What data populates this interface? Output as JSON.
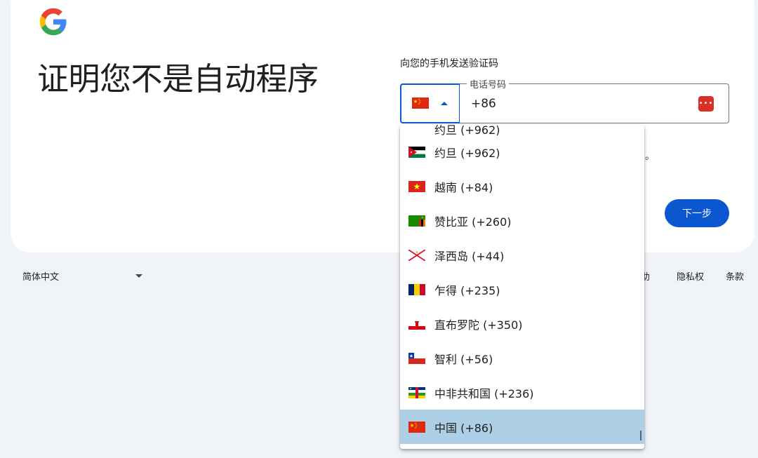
{
  "page": {
    "title": "证明您不是自动程序",
    "subtitle": "向您的手机发送验证码"
  },
  "country_select": {
    "selected_flag": "cn-flag-icon",
    "caret": "caret-up-icon"
  },
  "phone": {
    "label": "电话号码",
    "value": "+86",
    "password_manager_icon": "password-manager-icon"
  },
  "hidden_text_fragment": "。",
  "next_button": {
    "label": "下一步"
  },
  "dropdown": {
    "partial_item_top": "约旦 (+962)",
    "items": [
      {
        "label": "约旦 (+962)",
        "flag": "jordan-flag-icon",
        "selected": false
      },
      {
        "label": "越南 (+84)",
        "flag": "vietnam-flag-icon",
        "selected": false
      },
      {
        "label": "赞比亚 (+260)",
        "flag": "zambia-flag-icon",
        "selected": false
      },
      {
        "label": "泽西岛 (+44)",
        "flag": "jersey-flag-icon",
        "selected": false
      },
      {
        "label": "乍得 (+235)",
        "flag": "chad-flag-icon",
        "selected": false
      },
      {
        "label": "直布罗陀 (+350)",
        "flag": "gibraltar-flag-icon",
        "selected": false
      },
      {
        "label": "智利 (+56)",
        "flag": "chile-flag-icon",
        "selected": false
      },
      {
        "label": "中非共和国 (+236)",
        "flag": "central-african-republic-flag-icon",
        "selected": false
      },
      {
        "label": "中国 (+86)",
        "flag": "china-flag-icon",
        "selected": true
      }
    ]
  },
  "footer": {
    "language": "简体中文",
    "links": [
      "帮助",
      "隐私权",
      "条款"
    ]
  },
  "colors": {
    "accent": "#0b57d0",
    "selected_row": "#aed0e6",
    "background": "#f0f4f9"
  }
}
